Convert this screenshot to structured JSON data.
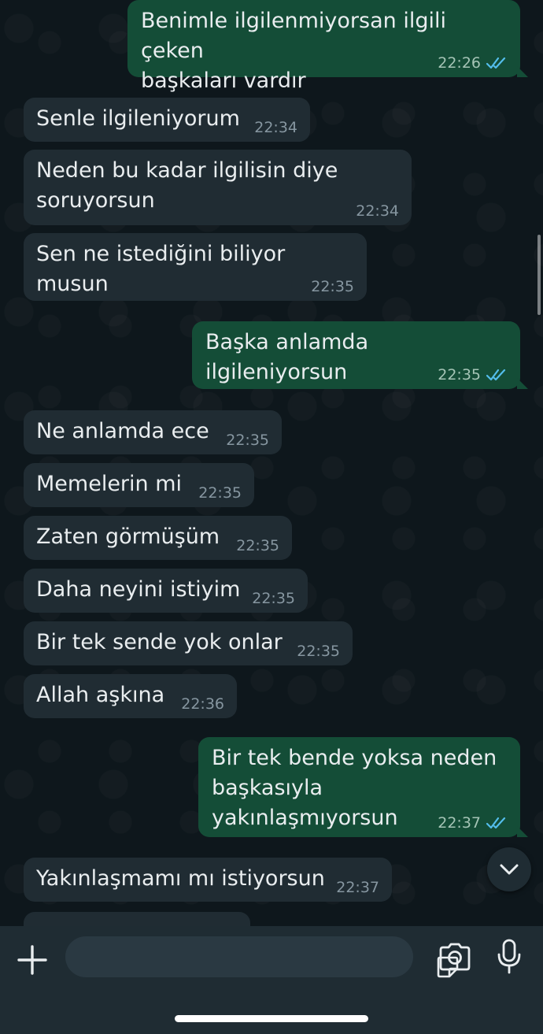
{
  "messages": [
    {
      "dir": "out",
      "text": "Benimle ilgilenmiyorsan ilgili çeken\nbaşkaları vardır",
      "time": "22:26"
    },
    {
      "dir": "in",
      "text": "Senle ilgileniyorum",
      "time": "22:34"
    },
    {
      "dir": "in",
      "text": "Neden bu kadar ilgilisin diye\nsoruyorsun",
      "time": "22:34"
    },
    {
      "dir": "in",
      "text": "Sen ne istediğini biliyor musun",
      "time": "22:35"
    },
    {
      "dir": "out",
      "text": "Başka anlamda ilgileniyorsun",
      "time": "22:35"
    },
    {
      "dir": "in",
      "text": "Ne anlamda ece",
      "time": "22:35"
    },
    {
      "dir": "in",
      "text": "Memelerin mi",
      "time": "22:35"
    },
    {
      "dir": "in",
      "text": "Zaten görmüşüm",
      "time": "22:35"
    },
    {
      "dir": "in",
      "text": "Daha neyini istiyim",
      "time": "22:35"
    },
    {
      "dir": "in",
      "text": "Bir tek sende yok onlar",
      "time": "22:35"
    },
    {
      "dir": "in",
      "text": "Allah aşkına",
      "time": "22:36"
    },
    {
      "dir": "out",
      "text": "Bir tek bende yoksa neden\nbaşkasıyla yakınlaşmıyorsun",
      "time": "22:37"
    },
    {
      "dir": "in",
      "text": "Yakınlaşmamı mı istiyorsun",
      "time": "22:37"
    }
  ],
  "icons": {
    "scroll_down": "chevron-down-icon",
    "attach": "plus-icon",
    "sticker": "sticker-icon",
    "camera": "camera-icon",
    "mic": "microphone-icon",
    "read_receipt": "double-check-icon"
  },
  "colors": {
    "outgoing_bubble": "#144d37",
    "incoming_bubble": "#202c33",
    "read_tick": "#53bdeb",
    "input_bar": "#1f2c33"
  }
}
